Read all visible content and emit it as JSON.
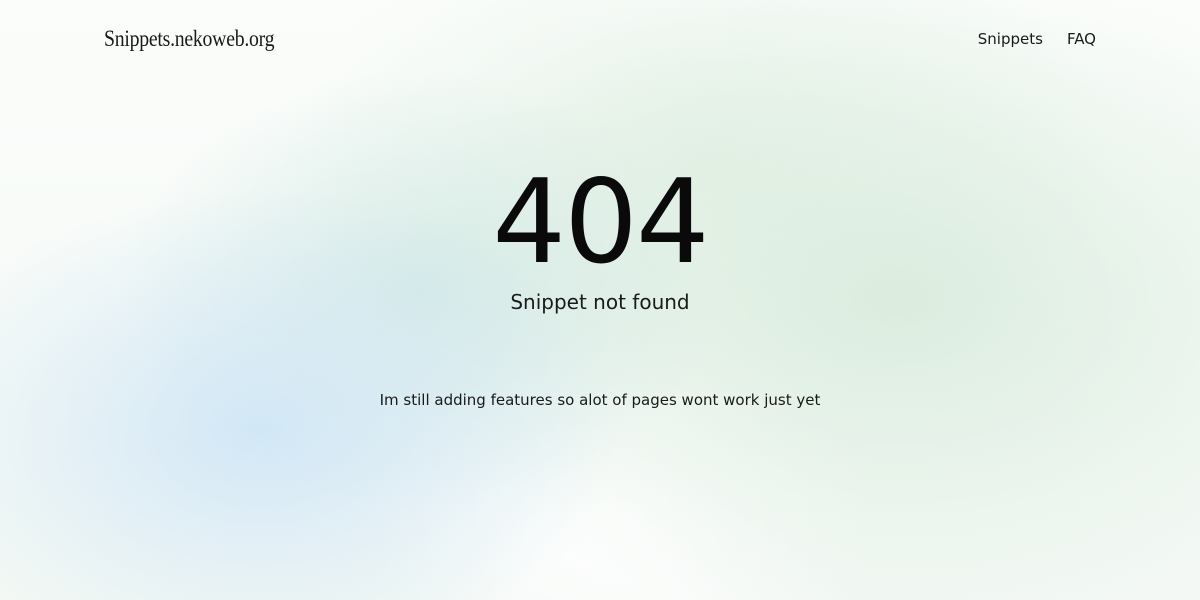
{
  "header": {
    "site_title": "Snippets.nekoweb.org",
    "nav": [
      {
        "label": "Snippets"
      },
      {
        "label": "FAQ"
      }
    ]
  },
  "main": {
    "error_code": "404",
    "error_message": "Snippet not found",
    "note": "Im still adding features so alot of pages wont work just yet"
  }
}
